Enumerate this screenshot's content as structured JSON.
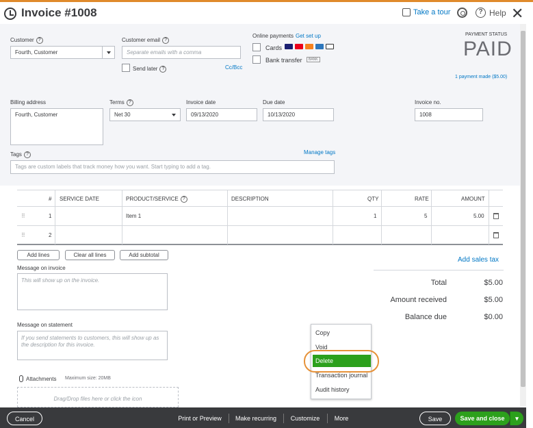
{
  "header": {
    "title": "Invoice #1008",
    "take_tour": "Take a tour",
    "help": "Help",
    "close": "✕"
  },
  "customer": {
    "label": "Customer",
    "value": "Fourth, Customer"
  },
  "email": {
    "label": "Customer email",
    "placeholder": "Separate emails with a comma",
    "send_later": "Send later",
    "cc_bcc": "Cc/Bcc"
  },
  "online_payments": {
    "label": "Online payments",
    "get_set_up": "Get set up",
    "cards": "Cards",
    "bank_transfer": "Bank transfer",
    "card_brands": [
      "VISA",
      "MC",
      "DISC",
      "AMEX",
      "Pay"
    ],
    "bank_tag": "BANK"
  },
  "payment_status": {
    "label": "PAYMENT STATUS",
    "value": "PAID",
    "payments_made": "1 payment made ($5.00)"
  },
  "billing": {
    "label": "Billing address",
    "value": "Fourth, Customer"
  },
  "terms": {
    "label": "Terms",
    "value": "Net 30"
  },
  "invoice_date": {
    "label": "Invoice date",
    "value": "09/13/2020"
  },
  "due_date": {
    "label": "Due date",
    "value": "10/13/2020"
  },
  "invoice_no": {
    "label": "Invoice no.",
    "value": "1008"
  },
  "tags": {
    "label": "Tags",
    "manage": "Manage tags",
    "placeholder": "Tags are custom labels that track money how you want. Start typing to add a tag."
  },
  "table": {
    "columns": [
      "#",
      "SERVICE DATE",
      "PRODUCT/SERVICE",
      "DESCRIPTION",
      "QTY",
      "RATE",
      "AMOUNT"
    ],
    "rows": [
      {
        "num": "1",
        "service_date": "",
        "product": "Item 1",
        "description": "",
        "qty": "1",
        "rate": "5",
        "amount": "5.00"
      },
      {
        "num": "2",
        "service_date": "",
        "product": "",
        "description": "",
        "qty": "",
        "rate": "",
        "amount": ""
      }
    ]
  },
  "line_buttons": {
    "add_lines": "Add lines",
    "clear_all": "Clear all lines",
    "add_subtotal": "Add subtotal"
  },
  "message_invoice": {
    "label": "Message on invoice",
    "placeholder": "This will show up on the invoice."
  },
  "message_statement": {
    "label": "Message on statement",
    "placeholder": "If you send statements to customers, this will show up as the description for this invoice."
  },
  "attachments": {
    "label": "Attachments",
    "max_size": "Maximum size: 20MB",
    "dropzone": "Drag/Drop files here or click the icon"
  },
  "totals": {
    "add_sales_tax": "Add sales tax",
    "total_label": "Total",
    "total_value": "$5.00",
    "received_label": "Amount received",
    "received_value": "$5.00",
    "balance_label": "Balance due",
    "balance_value": "$0.00"
  },
  "more_menu": {
    "items": [
      "Copy",
      "Void",
      "Delete",
      "Transaction journal",
      "Audit history"
    ],
    "selected": "Delete"
  },
  "footer": {
    "cancel": "Cancel",
    "print_preview": "Print or Preview",
    "make_recurring": "Make recurring",
    "customize": "Customize",
    "more": "More",
    "save": "Save",
    "save_close": "Save and close",
    "caret": "▾"
  },
  "colors": {
    "accent_green": "#2ca01c",
    "link_blue": "#0077c5",
    "footer_bg": "#393a3d",
    "highlight_ring": "#e69138"
  }
}
